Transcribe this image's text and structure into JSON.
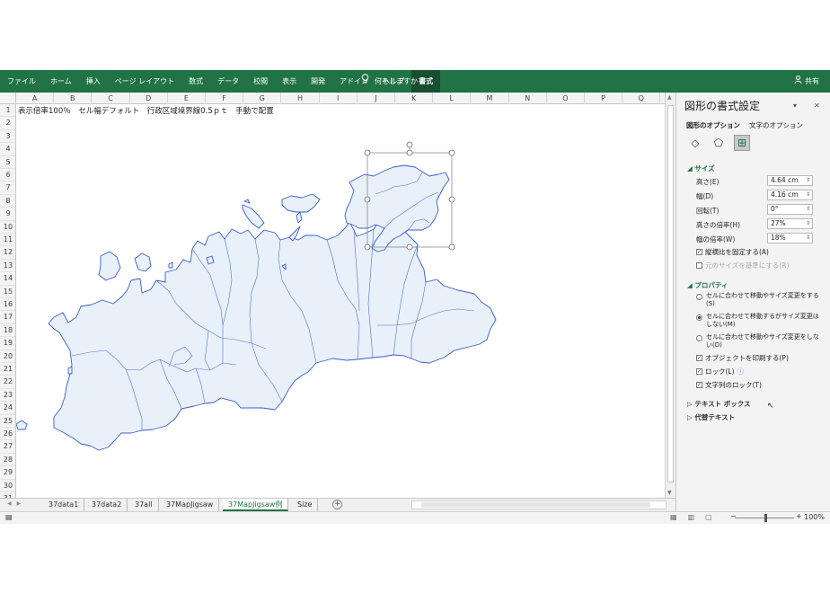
{
  "ribbon": {
    "tabs": [
      "ファイル",
      "ホーム",
      "挿入",
      "ページ レイアウト",
      "数式",
      "データ",
      "校閲",
      "表示",
      "開発",
      "アドイン",
      "ヘルプ",
      "書式"
    ],
    "active_tab": "書式",
    "tell_me": "何をしますか",
    "share": "共有"
  },
  "columns": [
    "A",
    "B",
    "C",
    "D",
    "E",
    "F",
    "G",
    "H",
    "I",
    "J",
    "K",
    "L",
    "M",
    "N",
    "O",
    "P",
    "Q"
  ],
  "rows": [
    "1",
    "2",
    "3",
    "4",
    "5",
    "6",
    "7",
    "8",
    "9",
    "10",
    "11",
    "12",
    "13",
    "14",
    "15",
    "16",
    "17",
    "18",
    "19",
    "20",
    "21",
    "22",
    "23",
    "24",
    "25",
    "26",
    "27",
    "28",
    "29",
    "30",
    "31"
  ],
  "cell_a1": "表示倍率100％　セル幅デフォルト　行政区域境界線0.5ｐｔ　手動で配置",
  "sheet_tabs": [
    "37data1",
    "37data2",
    "37all",
    "37MapJigsaw",
    "37MapJigsaw例",
    "Size"
  ],
  "active_sheet": "37MapJigsaw例",
  "status": {
    "zoom": "100%",
    "slider_fraction": 0.5
  },
  "pane": {
    "title": "図形の書式設定",
    "option_tabs": [
      "図形のオプション",
      "文字のオプション"
    ],
    "icons": [
      "fill-line-icon",
      "effects-icon",
      "size-properties-icon"
    ],
    "size_section": "サイズ",
    "fields": [
      {
        "label": "高さ(E)",
        "value": "4.64 cm"
      },
      {
        "label": "幅(D)",
        "value": "4.16 cm"
      },
      {
        "label": "回転(T)",
        "value": "0°"
      },
      {
        "label": "高さの倍率(H)",
        "value": "27%"
      },
      {
        "label": "幅の倍率(W)",
        "value": "18%"
      }
    ],
    "lock_aspect": "縦横比を固定する(A)",
    "relative_size": "元のサイズを基準にする(R)",
    "properties_section": "プロパティ",
    "radios": [
      "セルに合わせて移動やサイズ変更をする(S)",
      "セルに合わせて移動するがサイズ変更はしない(M)",
      "セルに合わせて移動やサイズ変更をしない(D)"
    ],
    "print_object": "オブジェクトを印刷する(P)",
    "lock": "ロック(L)",
    "lock_text": "文字列のロック(T)",
    "textbox": "テキスト ボックス",
    "alt_text": "代替テキスト"
  },
  "colors": {
    "accent": "#217346",
    "map_fill": "#e8f0fa",
    "map_stroke": "#3a5ccf"
  }
}
